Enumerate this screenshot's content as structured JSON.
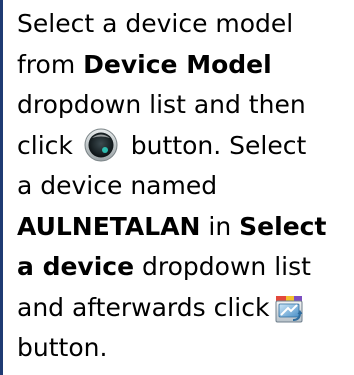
{
  "instruction": {
    "seg1": "Select a device model",
    "seg2": "from ",
    "seg3": "Device Model",
    "seg4": "dropdown list and then",
    "seg5": "click",
    "seg6": " button. Select",
    "seg7": "a device named",
    "seg8": "AULNETALAN",
    "seg9": " in ",
    "seg10": "Select",
    "seg11": "a device",
    "seg12": " dropdown list",
    "seg13": "and afterwards click",
    "seg14": "button."
  },
  "icons": {
    "first": "round-dark-lens-icon",
    "second": "install-software-icon"
  },
  "colors": {
    "left_bar": "#1f3b73",
    "text": "#000000"
  }
}
